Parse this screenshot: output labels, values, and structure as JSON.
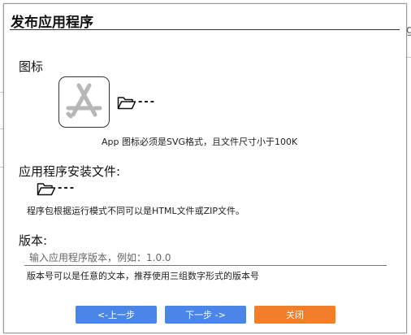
{
  "dialog": {
    "title": "发布应用程序"
  },
  "icon_section": {
    "label": "图标",
    "app_icon": "app-store-icon",
    "browse_icon": "folder-open-icon",
    "file_name": "---",
    "hint": "App 图标必须是SVG格式，且文件尺寸小于100K"
  },
  "package_section": {
    "label": "应用程序安装文件:",
    "browse_icon": "folder-open-icon",
    "file_name": "---",
    "hint": "程序包根据运行模式不同可以是HTML文件或ZIP文件。"
  },
  "version_section": {
    "label": "版本:",
    "value": "",
    "placeholder": "输入应用程序版本，例如：1.0.0",
    "hint": "版本号可以是任意的文本，推荐使用三组数字形式的版本号"
  },
  "buttons": {
    "prev": "<-上一步",
    "next": "下一步 ->",
    "close": "关闭"
  },
  "background_fragment": "g"
}
